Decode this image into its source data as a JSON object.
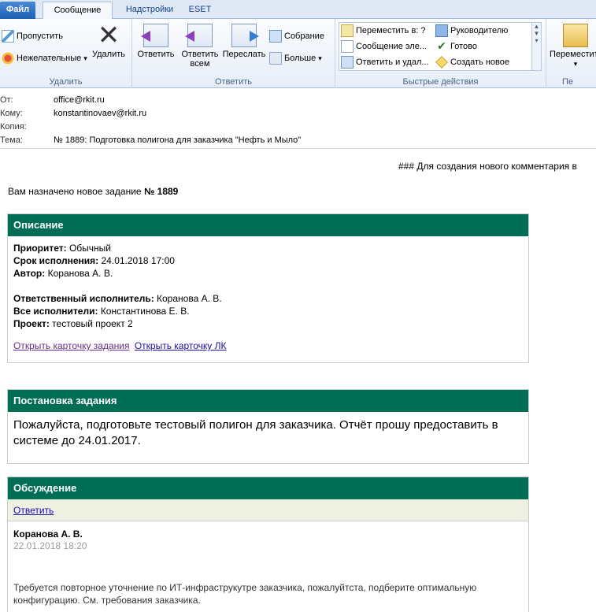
{
  "tabs": {
    "file": "Файл",
    "message": "Сообщение",
    "addins": "Надстройки",
    "eset": "ESET"
  },
  "ribbon": {
    "delete_group": {
      "ignore": "Пропустить",
      "junk": "Нежелательные",
      "junk_arrow": "▾",
      "delete": "Удалить",
      "label": "Удалить"
    },
    "reply_group": {
      "reply": "Ответить",
      "reply_all_line1": "Ответить",
      "reply_all_line2": "всем",
      "forward": "Переслать",
      "meeting": "Собрание",
      "more": "Больше",
      "more_arrow": "▾",
      "label": "Ответить"
    },
    "quick_steps": {
      "move_to": "Переместить в: ?",
      "to_manager": "Руководителю",
      "team_email": "Сообщение эле...",
      "done": "Готово",
      "reply_delete": "Ответить и удал...",
      "create_new": "Создать новое",
      "label": "Быстрые действия"
    },
    "move_group": {
      "move": "Переместить",
      "move_arrow": "▾",
      "label": "Пе"
    }
  },
  "headers": {
    "from_label": "От:",
    "from_value": "office@rkit.ru",
    "to_label": "Кому:",
    "to_value": "konstantinovaev@rkit.ru",
    "cc_label": "Копия:",
    "cc_value": "",
    "subject_label": "Тема:",
    "subject_value": "№ 1889: Подготовка полигона для заказчика \"Нефть и Мыло\""
  },
  "body": {
    "notice": "### Для создания нового комментария в",
    "assigned_prefix": "Вам назначено новое задание ",
    "assigned_number": "№ 1889",
    "description": {
      "title": "Описание",
      "priority_label": "Приоритет:",
      "priority_value": " Обычный",
      "deadline_label": "Срок исполнения:",
      "deadline_value": " 24.01.2018 17:00",
      "author_label": "Автор:",
      "author_value": " Коранова А. В.",
      "responsible_label": "Ответственный исполнитель:",
      "responsible_value": " Коранова А. В.",
      "executors_label": "Все исполнители:",
      "executors_value": " Константинова Е. В.",
      "project_label": "Проект:",
      "project_value": " тестовый проект 2",
      "link_task_card": "Открыть карточку задания",
      "link_lk_card": "Открыть карточку ЛК"
    },
    "task": {
      "title": "Постановка задания",
      "text": "Пожалуйста, подготовьте тестовый полигон для заказчика. Отчёт прошу предоставить в системе до 24.01.2017."
    },
    "discussion": {
      "title": "Обсуждение",
      "reply_link": "Ответить",
      "comment_author": "Коранова А. В.",
      "comment_date": "22.01.2018 18:20",
      "comment_text": "Требуется повторное уточнение по ИТ-инфраструкутре заказчика, пожалуйтста, подберите оптимальную конфигурацию. См. требования заказчика."
    }
  }
}
